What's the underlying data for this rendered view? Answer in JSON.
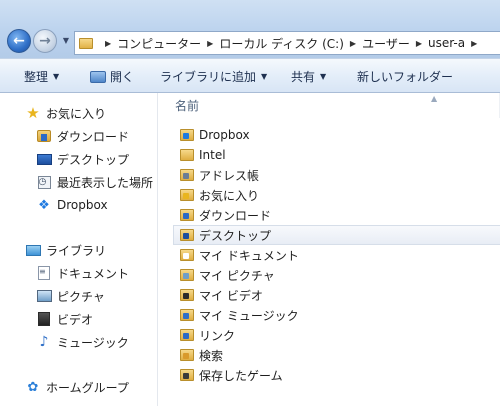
{
  "address": {
    "crumbs": [
      "コンピューター",
      "ローカル ディスク (C:)",
      "ユーザー",
      "user-a"
    ],
    "separator": "▶"
  },
  "toolbar": {
    "organize_label": "整理",
    "open_label": "開く",
    "include_library_label": "ライブラリに追加",
    "share_label": "共有",
    "new_folder_label": "新しいフォルダー",
    "dropdown_arrow": "▼"
  },
  "navigation": {
    "favorites": {
      "label": "お気に入り",
      "items": [
        {
          "label": "ダウンロード",
          "icon": "downloads-icon"
        },
        {
          "label": "デスクトップ",
          "icon": "desktop-icon"
        },
        {
          "label": "最近表示した場所",
          "icon": "recent-places-icon"
        },
        {
          "label": "Dropbox",
          "icon": "dropbox-icon"
        }
      ]
    },
    "libraries": {
      "label": "ライブラリ",
      "items": [
        {
          "label": "ドキュメント",
          "icon": "documents-icon"
        },
        {
          "label": "ピクチャ",
          "icon": "pictures-icon"
        },
        {
          "label": "ビデオ",
          "icon": "videos-icon"
        },
        {
          "label": "ミュージック",
          "icon": "music-icon"
        }
      ]
    },
    "homegroup": {
      "label": "ホームグループ"
    }
  },
  "file_list": {
    "column_header": "名前",
    "sort_indicator": "▲",
    "selected_index": 5,
    "items": [
      {
        "name": "Dropbox",
        "icon": "dropbox-folder-icon",
        "badge_color": "#1f7ae0"
      },
      {
        "name": "Intel",
        "icon": "folder-icon",
        "badge_color": ""
      },
      {
        "name": "アドレス帳",
        "icon": "contacts-folder-icon",
        "badge_color": "#6b7d96"
      },
      {
        "name": "お気に入り",
        "icon": "favorites-folder-icon",
        "badge_color": "#e9b51f"
      },
      {
        "name": "ダウンロード",
        "icon": "downloads-folder-icon",
        "badge_color": "#2b6ac6"
      },
      {
        "name": "デスクトップ",
        "icon": "desktop-folder-icon",
        "badge_color": "#1d4f9e"
      },
      {
        "name": "マイ ドキュメント",
        "icon": "documents-folder-icon",
        "badge_color": "#ffffff"
      },
      {
        "name": "マイ ピクチャ",
        "icon": "pictures-folder-icon",
        "badge_color": "#6f9ec8"
      },
      {
        "name": "マイ ビデオ",
        "icon": "videos-folder-icon",
        "badge_color": "#2b2b2b"
      },
      {
        "name": "マイ ミュージック",
        "icon": "music-folder-icon",
        "badge_color": "#2f6fc7"
      },
      {
        "name": "リンク",
        "icon": "links-folder-icon",
        "badge_color": "#2b6ac6"
      },
      {
        "name": "検索",
        "icon": "searches-folder-icon",
        "badge_color": "#d99a2b"
      },
      {
        "name": "保存したゲーム",
        "icon": "saved-games-folder-icon",
        "badge_color": "#3a3a3a"
      }
    ]
  },
  "colors": {
    "titlebar": "#bcd3ee",
    "selection": "#e8edf5",
    "header_text": "#4c607a"
  }
}
